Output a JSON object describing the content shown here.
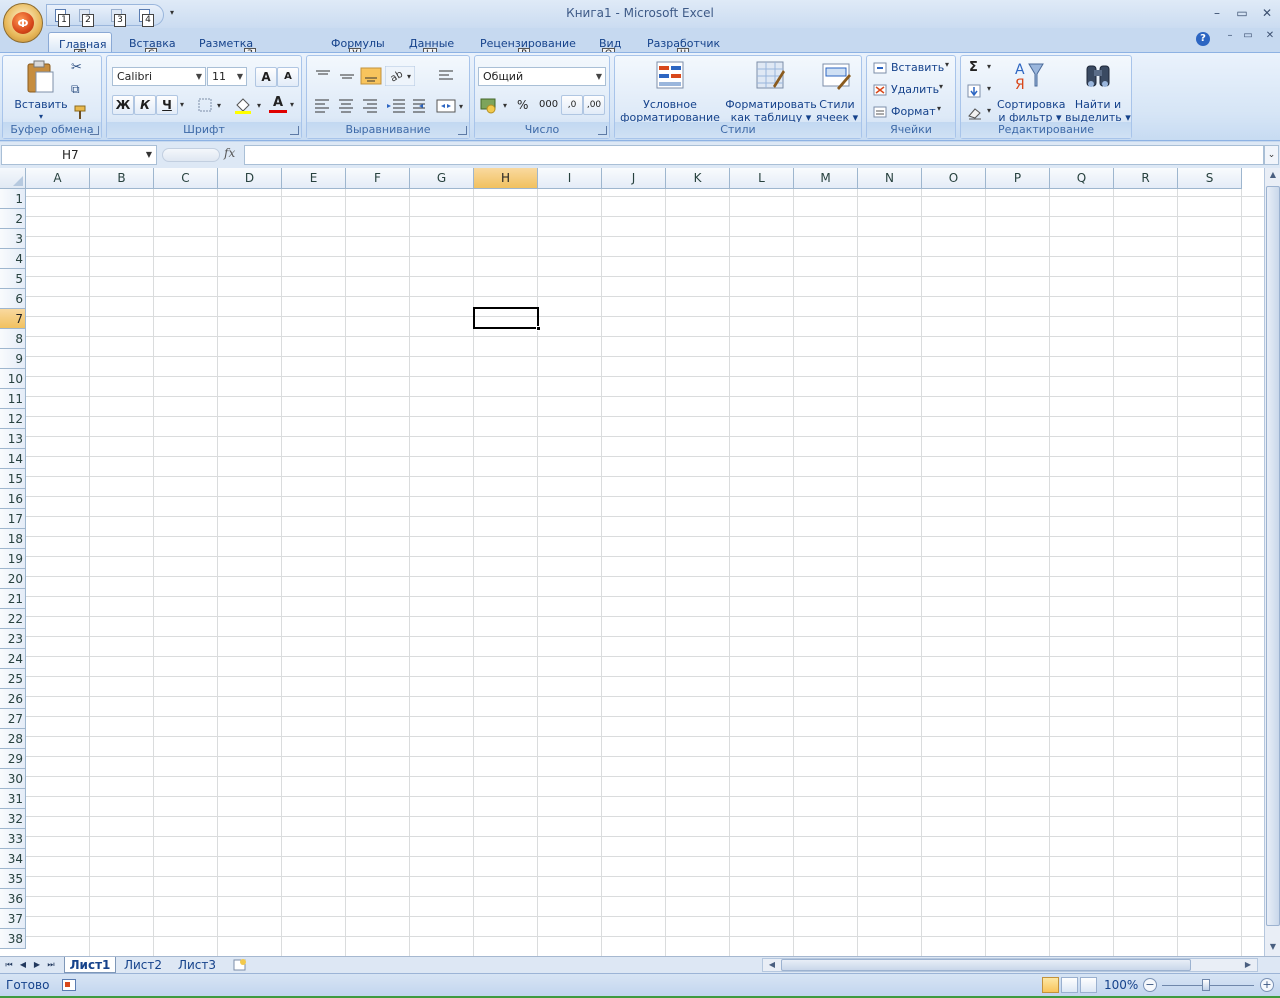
{
  "window": {
    "title": "Книга1 - Microsoft Excel",
    "office_button_logo": "Ф",
    "controls": [
      "–",
      "▭",
      "✕"
    ],
    "doc_controls": [
      "–",
      "▭",
      "✕"
    ]
  },
  "qat": {
    "keytips": [
      "1",
      "2",
      "3",
      "4"
    ],
    "customize": "▾"
  },
  "tabs": [
    {
      "label": "Главная",
      "key": "Я",
      "active": true
    },
    {
      "label": "Вставка",
      "key": "С"
    },
    {
      "label": "Разметка страницы",
      "key": "З"
    },
    {
      "label": "Формулы",
      "key": "У"
    },
    {
      "label": "Данные",
      "key": "Ы"
    },
    {
      "label": "Рецензирование",
      "key": "Р"
    },
    {
      "label": "Вид",
      "key": "О"
    },
    {
      "label": "Разработчик",
      "key": "Ч"
    }
  ],
  "help": "?",
  "ribbon": {
    "clipboard": {
      "label": "Буфер обмена",
      "paste": "Вставить",
      "cut_icon": "✂",
      "copy_icon": "⧉"
    },
    "font": {
      "label": "Шрифт",
      "font_name": "Calibri",
      "font_size": "11",
      "grow": "A",
      "shrink": "A",
      "bold": "Ж",
      "italic": "К",
      "underline": "Ч",
      "font_color_letter": "A"
    },
    "alignment": {
      "label": "Выравнивание"
    },
    "number": {
      "label": "Число",
      "format": "Общий",
      "percent": "%",
      "thousands": "000",
      "inc_decimal": ",0",
      "dec_decimal": ",00"
    },
    "styles": {
      "label": "Стили",
      "conditional_line1": "Условное",
      "conditional_line2": "форматирование",
      "table_line1": "Форматировать",
      "table_line2": "как таблицу",
      "cell_line1": "Стили",
      "cell_line2": "ячеек"
    },
    "cells": {
      "label": "Ячейки",
      "insert": "Вставить",
      "delete": "Удалить",
      "format": "Формат"
    },
    "editing": {
      "label": "Редактирование",
      "sum_icon": "Σ",
      "sort_line1": "Сортировка",
      "sort_line2": "и фильтр",
      "find_line1": "Найти и",
      "find_line2": "выделить"
    }
  },
  "formula_bar": {
    "name_box": "H7",
    "fx": "fx",
    "formula": ""
  },
  "grid": {
    "columns": [
      "A",
      "B",
      "C",
      "D",
      "E",
      "F",
      "G",
      "H",
      "I",
      "J",
      "K",
      "L",
      "M",
      "N",
      "O",
      "P",
      "Q",
      "R",
      "S"
    ],
    "rows": [
      "1",
      "2",
      "3",
      "4",
      "5",
      "6",
      "7",
      "8",
      "9",
      "10",
      "11",
      "12",
      "13",
      "14",
      "15",
      "16",
      "17",
      "18",
      "19",
      "20",
      "21",
      "22",
      "23",
      "24",
      "25",
      "26",
      "27",
      "28",
      "29",
      "30",
      "31",
      "32",
      "33",
      "34",
      "35",
      "36",
      "37",
      "38"
    ],
    "selected_column": "H",
    "selected_row": "7"
  },
  "sheets": [
    {
      "name": "Лист1",
      "active": true
    },
    {
      "name": "Лист2"
    },
    {
      "name": "Лист3"
    }
  ],
  "status": {
    "text": "Готово",
    "zoom": "100%",
    "minus": "−",
    "plus": "+"
  },
  "colors": {
    "accent": "#15428b",
    "selected_header": "#f1c15f",
    "ribbon_bg": "#dbe8f7"
  }
}
